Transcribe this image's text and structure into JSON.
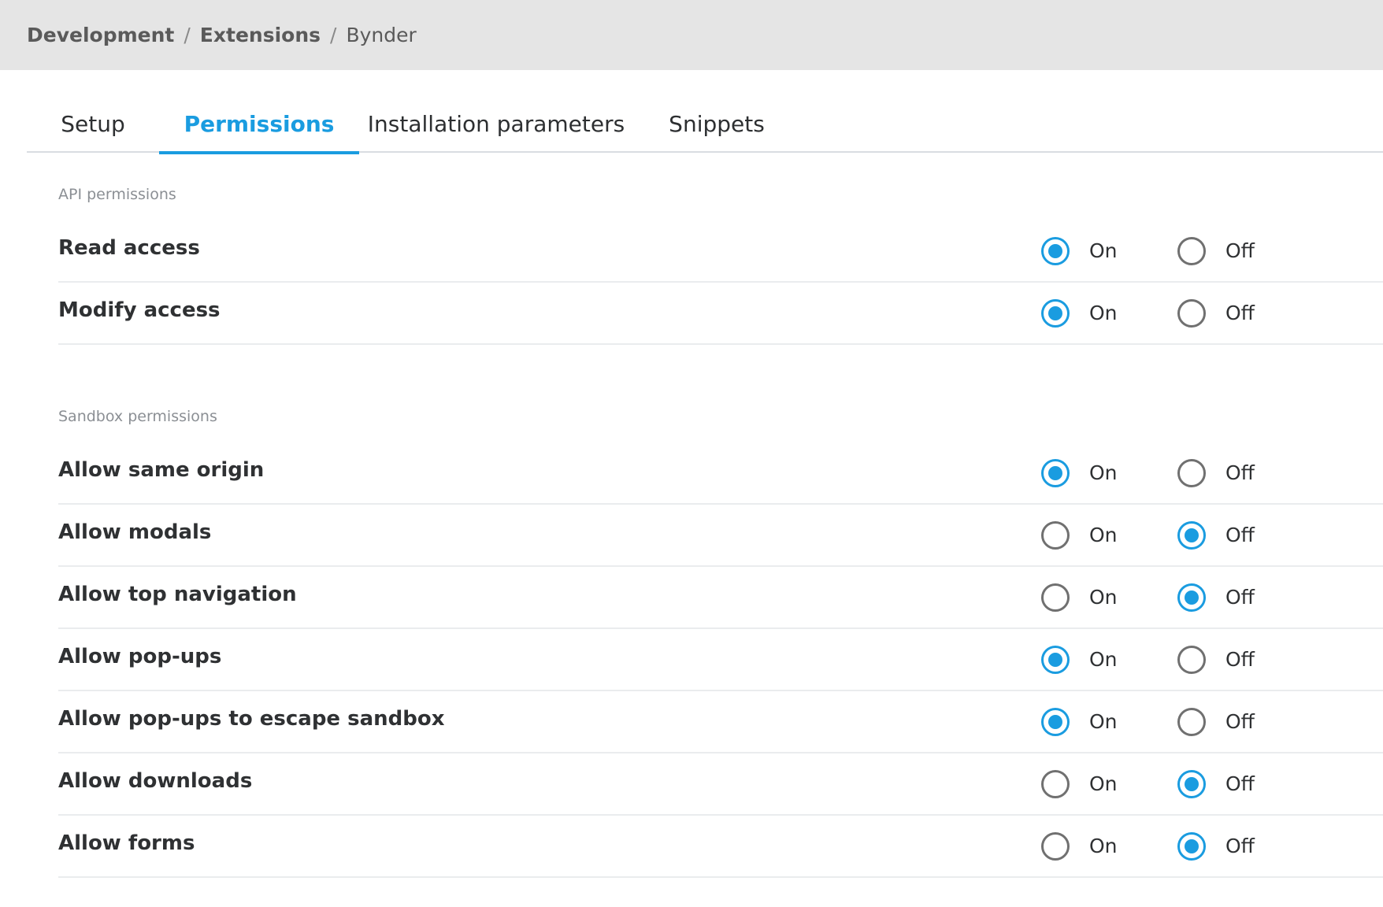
{
  "breadcrumb": {
    "items": [
      "Development",
      "Extensions"
    ],
    "separator": "/",
    "current": "Bynder"
  },
  "tabs": [
    {
      "label": "Setup",
      "active": false
    },
    {
      "label": "Permissions",
      "active": true
    },
    {
      "label": "Installation parameters",
      "active": false
    },
    {
      "label": "Snippets",
      "active": false
    }
  ],
  "api_permissions": {
    "heading": "API permissions",
    "items": [
      {
        "label": "Read access",
        "value": "On"
      },
      {
        "label": "Modify access",
        "value": "On"
      }
    ]
  },
  "sandbox_permissions": {
    "heading": "Sandbox permissions",
    "items": [
      {
        "label": "Allow same origin",
        "value": "On"
      },
      {
        "label": "Allow modals",
        "value": "Off"
      },
      {
        "label": "Allow top navigation",
        "value": "Off"
      },
      {
        "label": "Allow pop-ups",
        "value": "On"
      },
      {
        "label": "Allow pop-ups to escape sandbox",
        "value": "On"
      },
      {
        "label": "Allow downloads",
        "value": "Off"
      },
      {
        "label": "Allow forms",
        "value": "Off"
      }
    ]
  },
  "options": {
    "on_label": "On",
    "off_label": "Off"
  },
  "colors": {
    "accent": "#1a9ce0",
    "header_bg": "#e5e5e5"
  }
}
